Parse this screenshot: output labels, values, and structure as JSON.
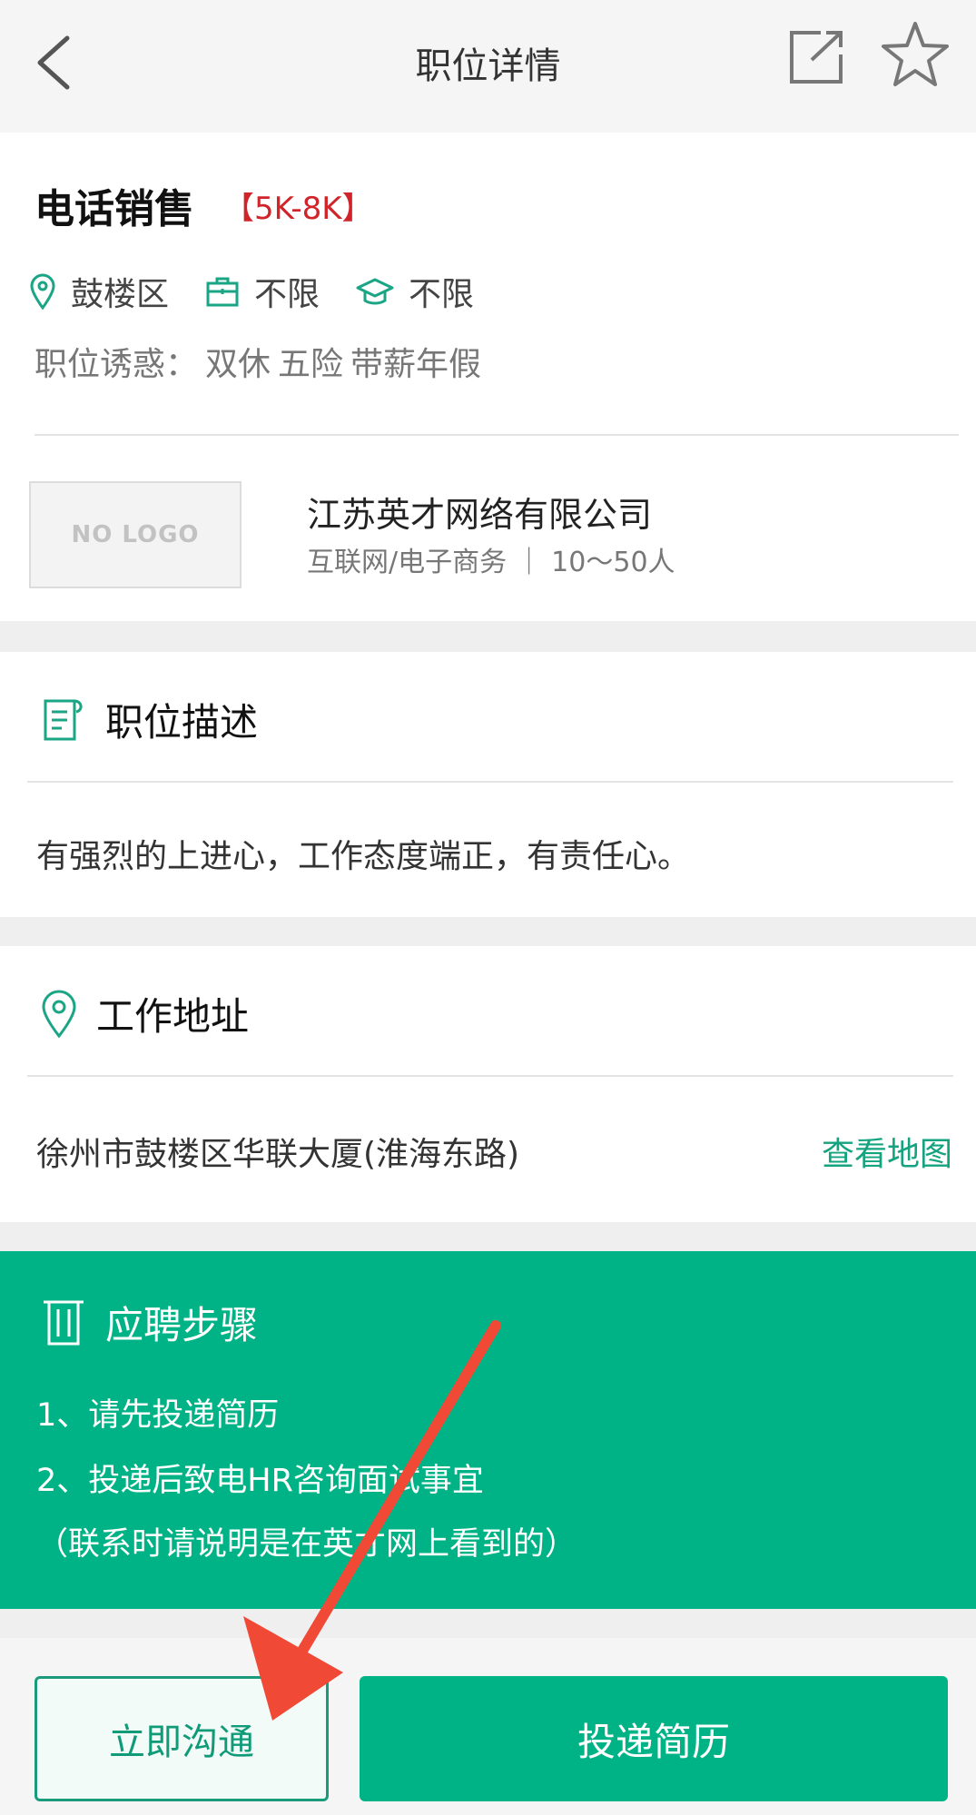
{
  "header": {
    "title": "职位详情"
  },
  "job": {
    "title": "电话销售",
    "salary": "【5K-8K】",
    "location": "鼓楼区",
    "experience": "不限",
    "education": "不限",
    "perks_label": "职位诱惑：",
    "perks": [
      "双休",
      "五险",
      "带薪年假"
    ]
  },
  "company": {
    "logo_text": "NO LOGO",
    "name": "江苏英才网络有限公司",
    "info": "互联网/电子商务 ｜ 10～50人"
  },
  "description": {
    "heading": "职位描述",
    "text": "有强烈的上进心，工作态度端正，有责任心。"
  },
  "address": {
    "heading": "工作地址",
    "text": "徐州市鼓楼区华联大厦(淮海东路)",
    "map_link": "查看地图"
  },
  "steps": {
    "heading": "应聘步骤",
    "lines": [
      "1、请先投递简历",
      "2、投递后致电HR咨询面试事宜",
      "（联系时请说明是在英才网上看到的）"
    ]
  },
  "actions": {
    "chat_label": "立即沟通",
    "apply_label": "投递简历"
  },
  "colors": {
    "accent": "#00b386",
    "salary": "#d0242a",
    "annotation_arrow": "#f04a36"
  }
}
